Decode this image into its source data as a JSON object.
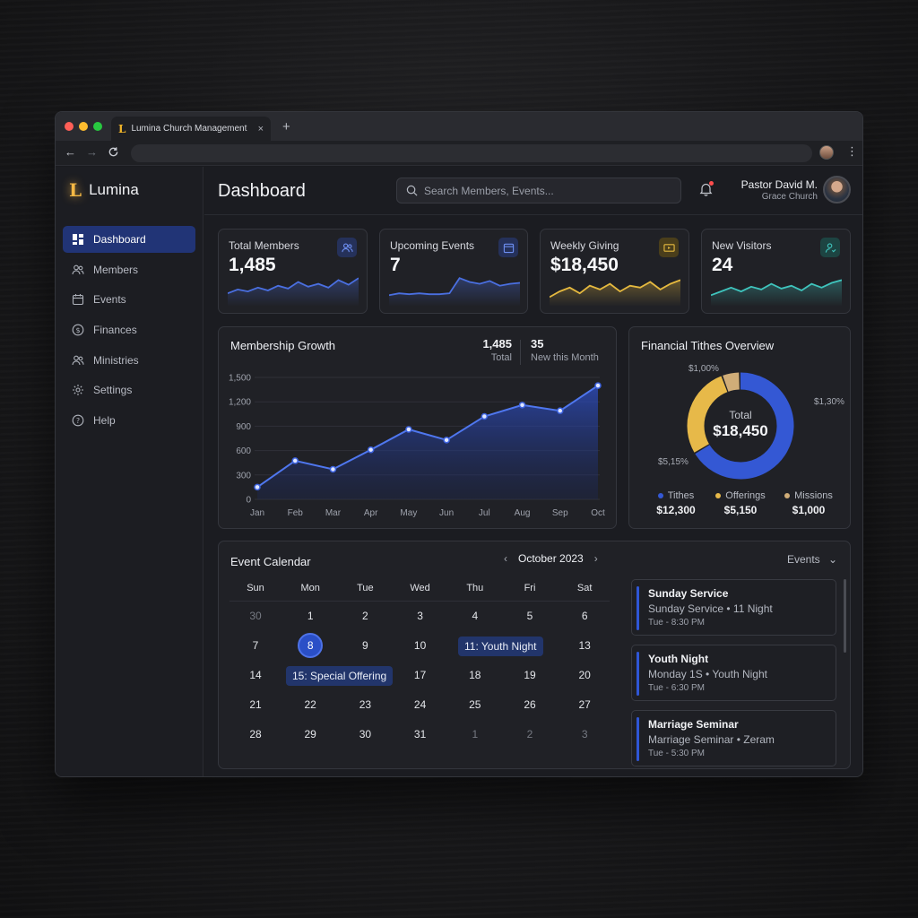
{
  "browser": {
    "tab_title": "Lumina Church Management",
    "tab_close": "×",
    "new_tab": "+",
    "back": "←",
    "forward": "→",
    "reload": "C",
    "menu": "⋮"
  },
  "brand": {
    "mark": "L",
    "name": "Lumina"
  },
  "sidebar": {
    "items": [
      {
        "label": "Dashboard",
        "icon": "dashboard-icon",
        "active": true
      },
      {
        "label": "Members",
        "icon": "members-icon"
      },
      {
        "label": "Events",
        "icon": "calendar-icon"
      },
      {
        "label": "Finances",
        "icon": "dollar-icon"
      },
      {
        "label": "Ministries",
        "icon": "ministries-icon"
      },
      {
        "label": "Settings",
        "icon": "gear-icon"
      },
      {
        "label": "Help",
        "icon": "help-icon"
      }
    ]
  },
  "header": {
    "title": "Dashboard",
    "search_placeholder": "Search Members, Events...",
    "user_name": "Pastor David M.",
    "user_org": "Grace Church"
  },
  "stats": [
    {
      "title": "Total Members",
      "value": "1,485",
      "icon": "members-icon",
      "color": "#4a6fe0",
      "spark": [
        14,
        18,
        16,
        20,
        17,
        22,
        19,
        26,
        21,
        24,
        20,
        28,
        23,
        30
      ]
    },
    {
      "title": "Upcoming Events",
      "value": "7",
      "icon": "calendar-icon",
      "color": "#4a6fe0",
      "spark": [
        12,
        14,
        13,
        14,
        13,
        13,
        14,
        30,
        26,
        24,
        27,
        22,
        24,
        25
      ]
    },
    {
      "title": "Weekly Giving",
      "value": "$18,450",
      "icon": "giving-icon",
      "color": "#e5b93f",
      "spark": [
        10,
        16,
        20,
        14,
        22,
        18,
        24,
        16,
        22,
        20,
        26,
        18,
        24,
        28
      ]
    },
    {
      "title": "New Visitors",
      "value": "24",
      "icon": "visitor-icon",
      "color": "#3fc4bd",
      "spark": [
        12,
        16,
        20,
        16,
        21,
        18,
        24,
        19,
        22,
        17,
        24,
        20,
        25,
        28
      ]
    }
  ],
  "membership": {
    "title": "Membership Growth",
    "total_value": "1,485",
    "total_label": "Total",
    "new_value": "35",
    "new_label": "New this Month"
  },
  "chart_data": {
    "type": "area",
    "title": "Membership Growth",
    "categories": [
      "Jan",
      "Feb",
      "Mar",
      "Apr",
      "May",
      "Jun",
      "Jul",
      "Aug",
      "Sep",
      "Oct"
    ],
    "values": [
      150,
      475,
      370,
      610,
      860,
      730,
      1020,
      1160,
      1090,
      1400
    ],
    "ylim": [
      0,
      1500
    ],
    "yticks": [
      "0",
      "300",
      "600",
      "900",
      "1,200",
      "1,500"
    ],
    "grid": true
  },
  "tithes": {
    "title": "Financial Tithes Overview",
    "center_label": "Total",
    "center_value": "$18,450",
    "slices": [
      {
        "name": "Tithes",
        "amount": "$12,300",
        "value": 12300,
        "color": "#3458d4",
        "callout": "$1,30%"
      },
      {
        "name": "Offerings",
        "amount": "$5,150",
        "value": 5150,
        "color": "#e7b949",
        "callout": "$5,15%"
      },
      {
        "name": "Missions",
        "amount": "$1,000",
        "value": 1000,
        "color": "#d0ad78",
        "callout": "$1,00%"
      }
    ]
  },
  "calendar": {
    "title": "Event Calendar",
    "month": "October 2023",
    "prev": "‹",
    "next": "›",
    "filter": "Events",
    "filter_arrow": "⌄",
    "weekdays": [
      "Sun",
      "Mon",
      "Tue",
      "Wed",
      "Thu",
      "Fri",
      "Sat"
    ],
    "weeks": [
      [
        "30",
        "1",
        "2",
        "3",
        "4",
        "5",
        "6"
      ],
      [
        "7",
        "8",
        "9",
        "10",
        "",
        "",
        "13"
      ],
      [
        "14",
        "",
        "",
        "17",
        "18",
        "19",
        "20"
      ],
      [
        "21",
        "22",
        "23",
        "24",
        "25",
        "26",
        "27"
      ],
      [
        "28",
        "29",
        "30",
        "31",
        "1",
        "2",
        "3"
      ]
    ],
    "pill_youth": "11: Youth Night",
    "pill_offering": "15: Special Offering",
    "events": [
      {
        "title": "Sunday Service",
        "subtitle": "Sunday Service • 11 Night",
        "time": "Tue - 8:30 PM"
      },
      {
        "title": "Youth Night",
        "subtitle": "Monday 1S • Youth Night",
        "time": "Tue - 6:30 PM"
      },
      {
        "title": "Marriage Seminar",
        "subtitle": "Marriage Seminar • Zeram",
        "time": "Tue - 5:30 PM"
      }
    ]
  }
}
